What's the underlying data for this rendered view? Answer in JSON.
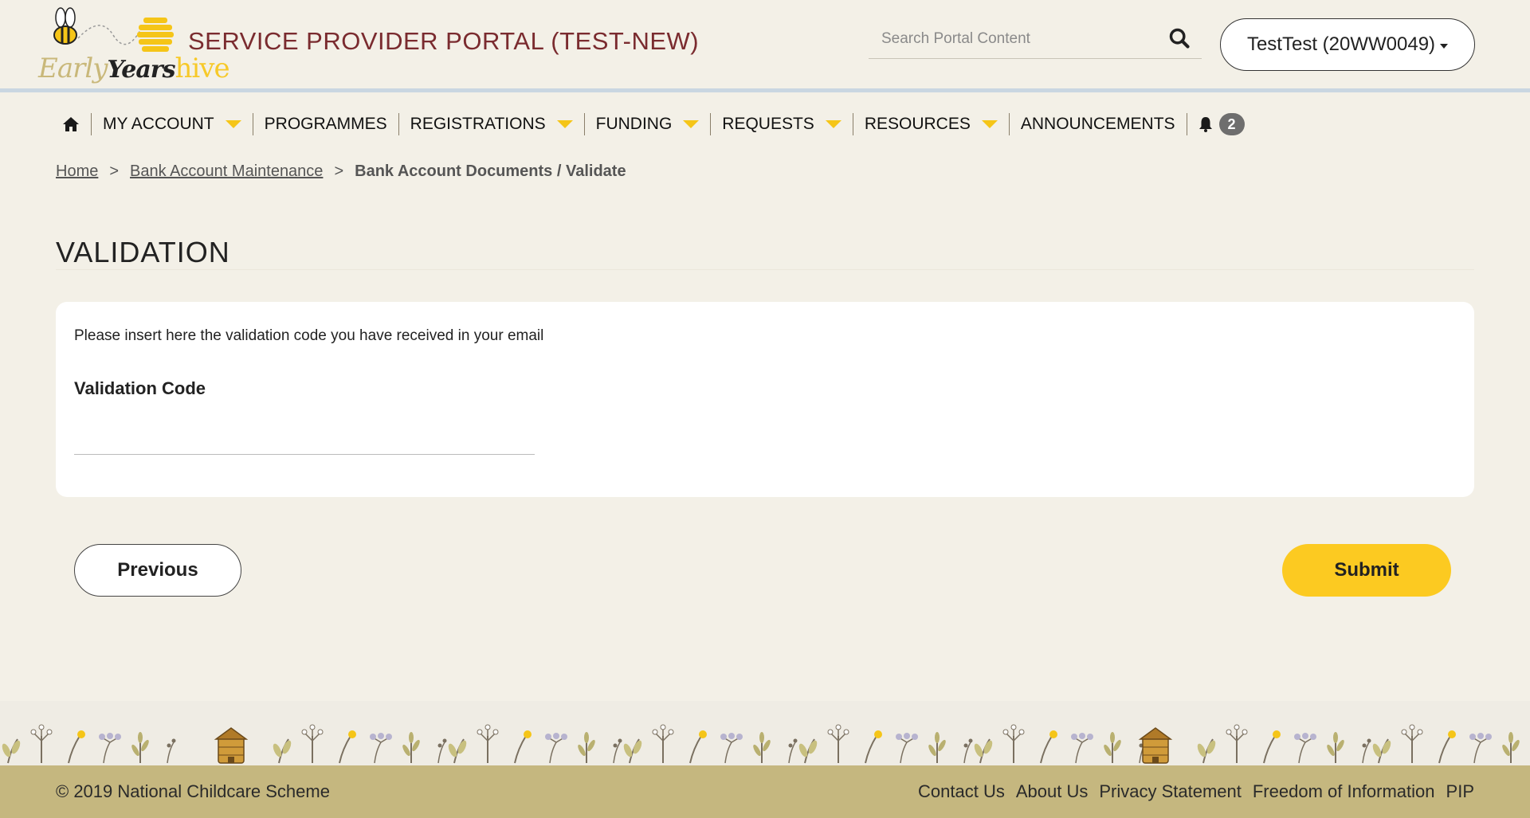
{
  "header": {
    "logo": {
      "early": "Early",
      "years": "Years",
      "hive": "hive"
    },
    "portal_title": "SERVICE PROVIDER PORTAL (TEST-NEW)",
    "search_placeholder": "Search Portal Content",
    "account_label": "TestTest (20WW0049)"
  },
  "nav": {
    "items": [
      {
        "label": "MY ACCOUNT",
        "dropdown": true
      },
      {
        "label": "PROGRAMMES",
        "dropdown": false
      },
      {
        "label": "REGISTRATIONS",
        "dropdown": true
      },
      {
        "label": "FUNDING",
        "dropdown": true
      },
      {
        "label": "REQUESTS",
        "dropdown": true
      },
      {
        "label": "RESOURCES",
        "dropdown": true
      },
      {
        "label": "ANNOUNCEMENTS",
        "dropdown": false
      }
    ],
    "notification_count": "2"
  },
  "breadcrumb": {
    "home": "Home",
    "parent": "Bank Account Maintenance",
    "current": "Bank Account Documents / Validate",
    "separator": ">"
  },
  "page": {
    "title": "VALIDATION",
    "instruction": "Please insert here the validation code you have received in your email",
    "field_label": "Validation Code",
    "field_value": ""
  },
  "buttons": {
    "previous": "Previous",
    "submit": "Submit"
  },
  "footer": {
    "copyright": "© 2019 National Childcare Scheme",
    "links": [
      "Contact Us",
      "About Us",
      "Privacy Statement",
      "Freedom of Information",
      "PIP"
    ]
  },
  "colors": {
    "background": "#f3f0e7",
    "title_maroon": "#7a2b2f",
    "accent_yellow": "#fcca21",
    "footer_bar": "#c5b77f",
    "header_rule": "#c9d6e1"
  }
}
